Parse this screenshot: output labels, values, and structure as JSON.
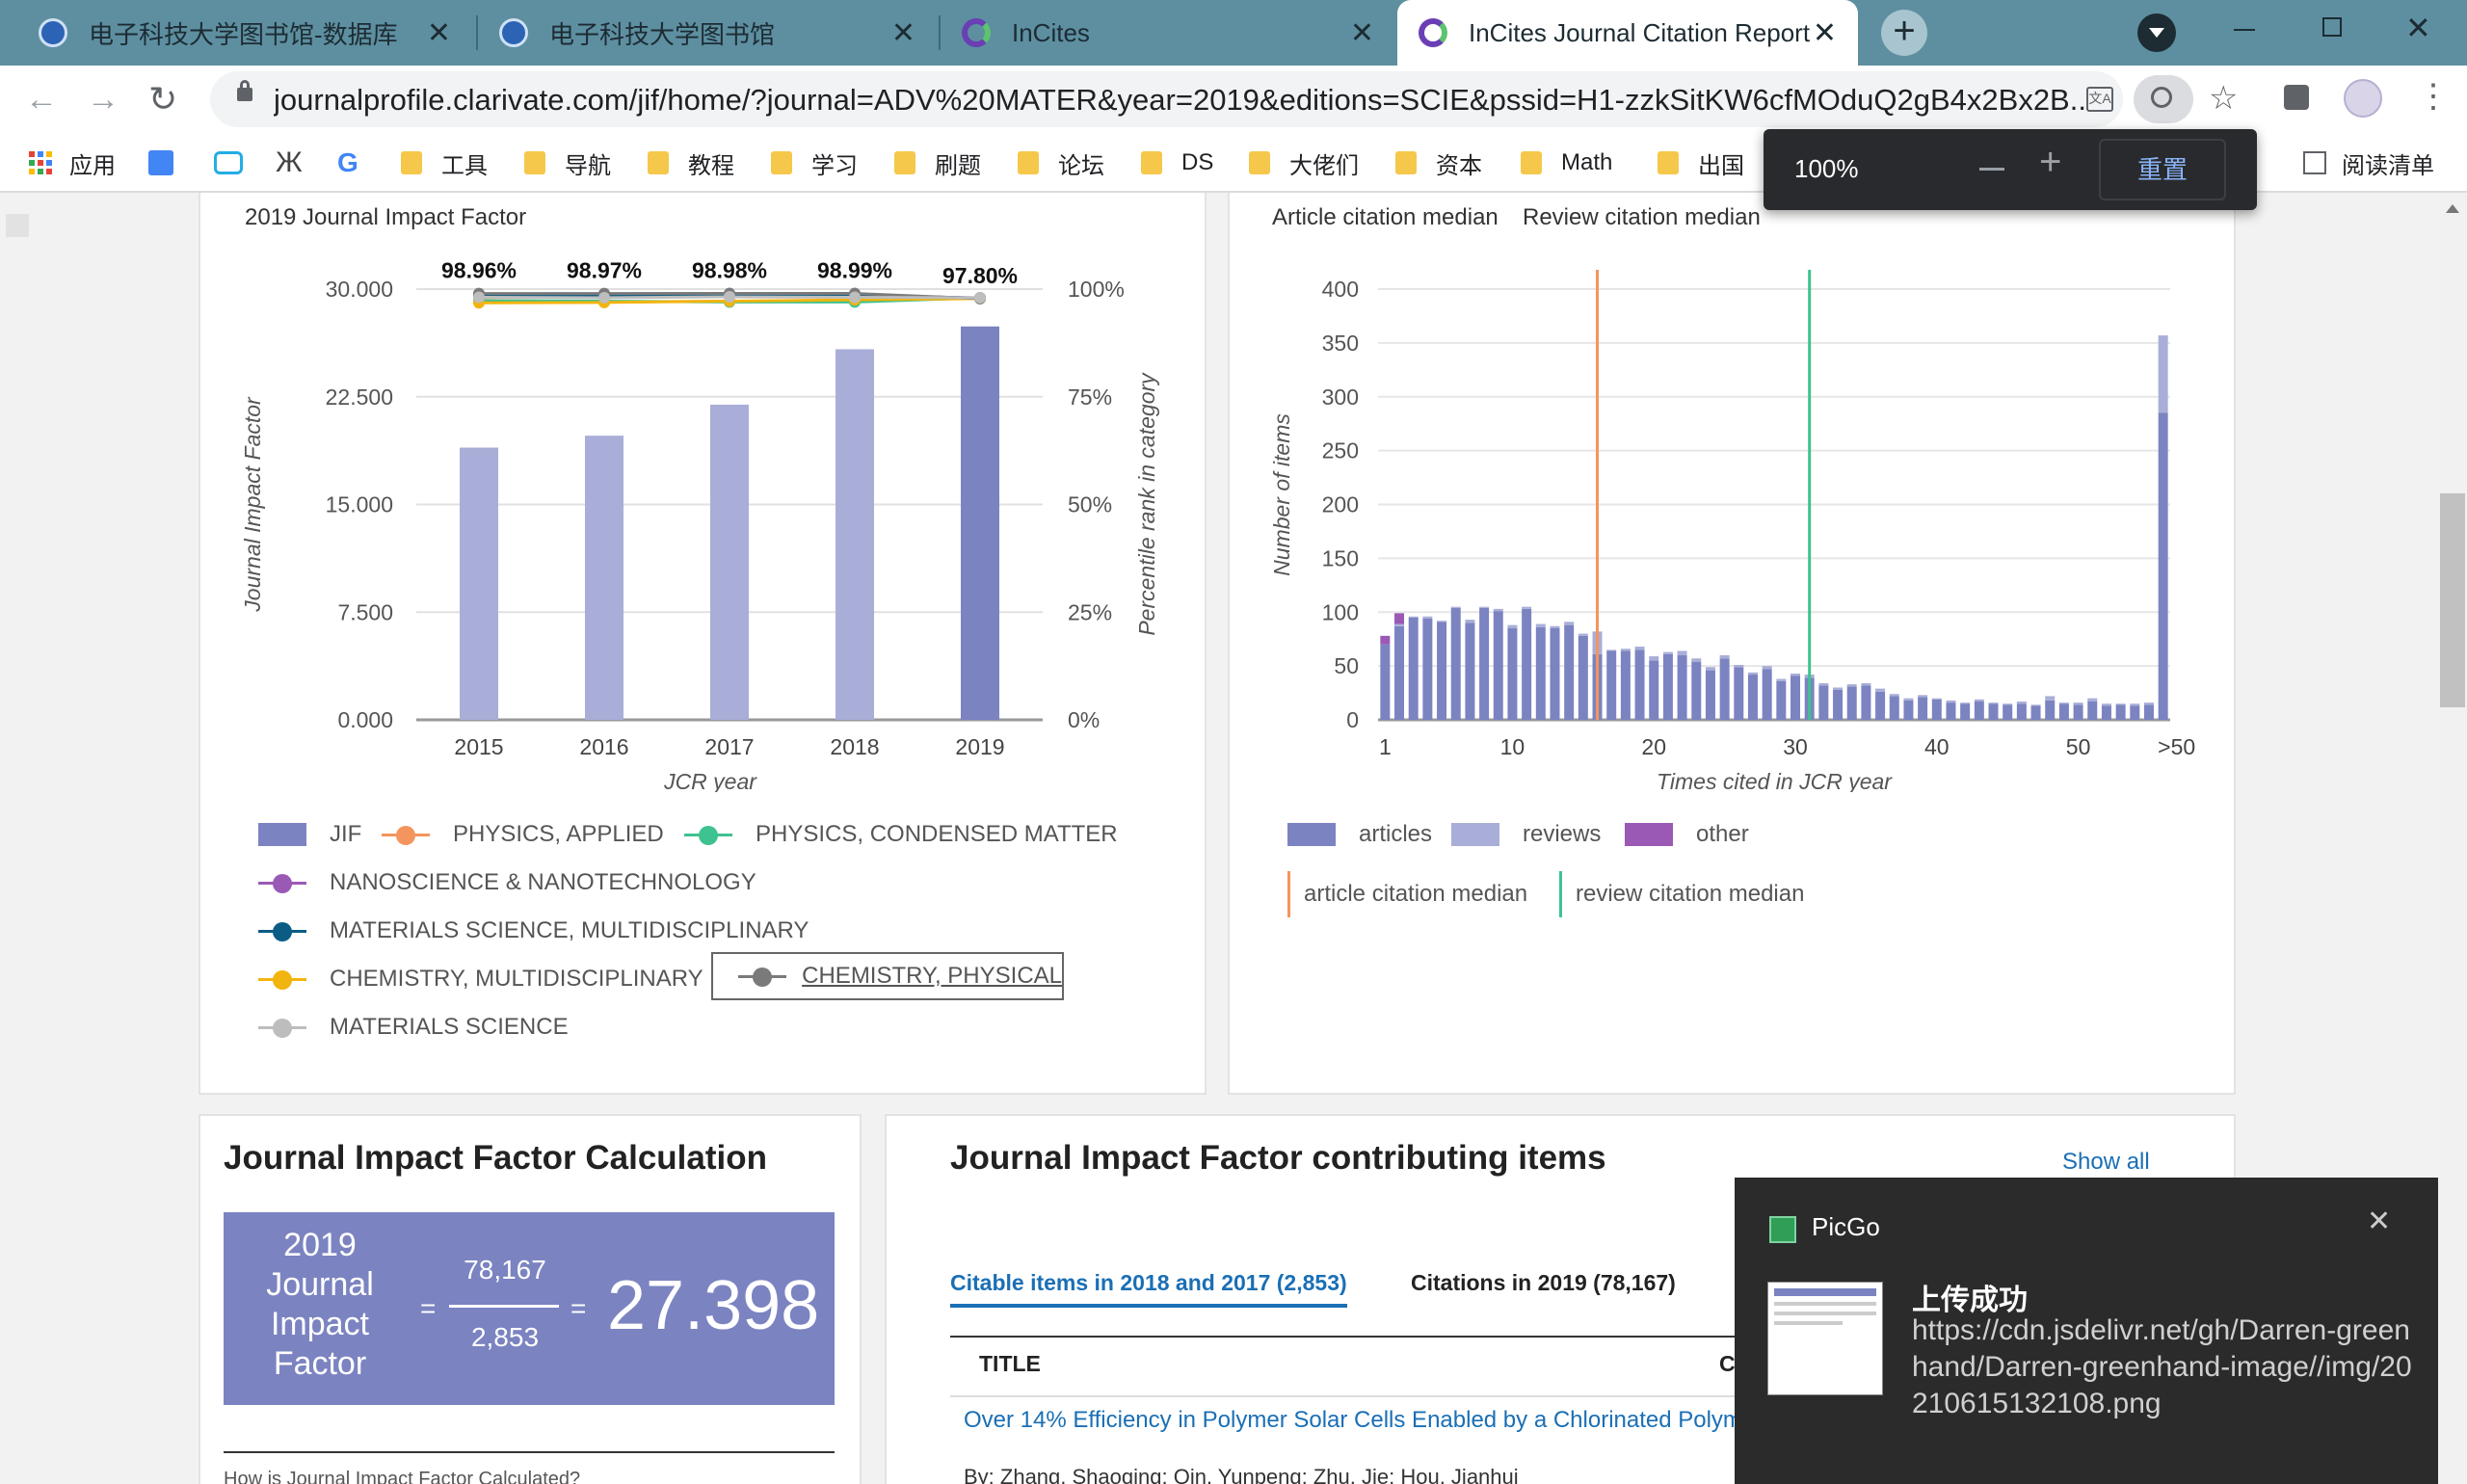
{
  "tabs": [
    {
      "title": "电子科技大学图书馆-数据库",
      "active": false
    },
    {
      "title": "电子科技大学图书馆",
      "active": false
    },
    {
      "title": "InCites",
      "active": false
    },
    {
      "title": "InCites Journal Citation Report",
      "active": true
    }
  ],
  "toolbar": {
    "url": "journalprofile.clarivate.com/jif/home/?journal=ADV%20MATER&year=2019&editions=SCIE&pssid=H1-zzkSitKW6cfMOduQ2gB4x2Bx2B..."
  },
  "bookmarks": {
    "apps_label": "应用",
    "items": [
      "工具",
      "导航",
      "教程",
      "学习",
      "刷题",
      "论坛",
      "DS",
      "大佬们",
      "资本",
      "Math",
      "出国"
    ],
    "reading_list": "阅读清单"
  },
  "zoom": {
    "level": "100%",
    "reset_label": "重置"
  },
  "jif_chart": {
    "title": "2019 Journal Impact Factor",
    "chart_data": {
      "type": "bar",
      "categories": [
        "2015",
        "2016",
        "2017",
        "2018",
        "2019"
      ],
      "values": [
        18.96,
        19.79,
        21.95,
        25.81,
        27.398
      ],
      "ylim": [
        0,
        30
      ],
      "y_ticks": [
        "0.000",
        "7.500",
        "15.000",
        "22.500",
        "30.000"
      ],
      "y2_ticks": [
        "0%",
        "25%",
        "50%",
        "75%",
        "100%"
      ],
      "xlabel": "JCR year",
      "ylabel": "Journal Impact Factor",
      "y2label": "Percentile rank in category",
      "percentile_labels": [
        "98.96%",
        "98.97%",
        "98.98%",
        "98.99%",
        "97.80%"
      ],
      "percentile_series": [
        {
          "name": "PHYSICS, APPLIED",
          "color": "#f4955e",
          "values": [
            97.4,
            97.0,
            97.2,
            97.3,
            97.9
          ]
        },
        {
          "name": "PHYSICS, CONDENSED MATTER",
          "color": "#3ec28f",
          "values": [
            97.3,
            97.2,
            97.0,
            97.0,
            98.0
          ]
        },
        {
          "name": "NANOSCIENCE & NANOTECHNOLOGY",
          "color": "#9b59b6",
          "values": [
            98.6,
            98.3,
            98.5,
            98.4,
            98.0
          ]
        },
        {
          "name": "MATERIALS SCIENCE, MULTIDISCIPLINARY",
          "color": "#0b5c85",
          "values": [
            98.4,
            98.6,
            98.4,
            98.6,
            97.9
          ]
        },
        {
          "name": "CHEMISTRY, MULTIDISCIPLINARY",
          "color": "#f2b40e",
          "values": [
            96.8,
            96.9,
            97.2,
            97.5,
            97.8
          ]
        },
        {
          "name": "CHEMISTRY, PHYSICAL",
          "color": "#7a7a7a",
          "values": [
            98.96,
            98.97,
            98.98,
            98.99,
            97.8
          ]
        },
        {
          "name": "MATERIALS SCIENCE",
          "color": "#bdbdbd",
          "values": [
            98.1,
            98.0,
            98.2,
            98.1,
            98.0
          ]
        }
      ]
    },
    "legend": {
      "jif": "JIF",
      "items": [
        "PHYSICS, APPLIED",
        "PHYSICS, CONDENSED MATTER",
        "NANOSCIENCE & NANOTECHNOLOGY",
        "MATERIALS SCIENCE, MULTIDISCIPLINARY",
        "CHEMISTRY, MULTIDISCIPLINARY",
        "CHEMISTRY, PHYSICAL",
        "MATERIALS SCIENCE"
      ]
    }
  },
  "citation_chart": {
    "header_article": "Article citation median",
    "header_review": "Review citation median",
    "chart_data": {
      "type": "bar",
      "xlabel": "Times cited in JCR year",
      "ylabel": "Number of items",
      "ylim": [
        0,
        400
      ],
      "y_ticks": [
        "0",
        "50",
        "100",
        "150",
        "200",
        "250",
        "300",
        "350",
        "400"
      ],
      "x_ticks": [
        "1",
        "10",
        "20",
        "30",
        "40",
        "50",
        ">50"
      ],
      "article_median": 16,
      "review_median": 31,
      "series": [
        {
          "name": "articles",
          "color": "#7b83c1",
          "values": [
            70,
            87,
            95,
            94,
            91,
            104,
            90,
            104,
            101,
            85,
            103,
            86,
            85,
            88,
            78,
            61,
            64,
            64,
            65,
            55,
            61,
            60,
            54,
            46,
            57,
            49,
            42,
            47,
            36,
            41,
            39,
            32,
            28,
            31,
            32,
            26,
            22,
            18,
            21,
            19,
            16,
            15,
            17,
            15,
            14,
            15,
            13,
            18,
            15,
            14,
            17,
            13,
            14,
            13,
            14,
            285
          ]
        },
        {
          "name": "reviews",
          "color": "#a9aed8",
          "values": [
            0,
            2,
            1,
            2,
            1,
            1,
            3,
            1,
            2,
            3,
            2,
            3,
            2,
            3,
            2,
            21,
            1,
            2,
            3,
            4,
            2,
            4,
            3,
            3,
            3,
            2,
            2,
            3,
            2,
            2,
            3,
            2,
            2,
            2,
            2,
            3,
            2,
            2,
            2,
            1,
            2,
            1,
            2,
            1,
            1,
            2,
            1,
            4,
            1,
            2,
            3,
            2,
            1,
            2,
            2,
            72
          ]
        },
        {
          "name": "other",
          "color": "#9b59b6",
          "values": [
            8,
            10,
            0,
            0,
            0,
            0,
            0,
            0,
            0,
            0,
            0,
            0,
            0,
            0,
            0,
            0,
            0,
            0,
            0,
            0,
            0,
            0,
            0,
            0,
            0,
            0,
            0,
            0,
            0,
            0,
            0,
            0,
            0,
            0,
            0,
            0,
            0,
            0,
            0,
            0,
            0,
            0,
            0,
            0,
            0,
            0,
            0,
            0,
            0,
            0,
            0,
            0,
            0,
            0,
            0,
            0
          ]
        }
      ],
      "article_median_color": "#f4955e",
      "review_median_color": "#3ec28f"
    },
    "legend": {
      "articles": "articles",
      "reviews": "reviews",
      "other": "other",
      "article_median": "article citation median",
      "review_median": "review citation median"
    }
  },
  "calc": {
    "title": "Journal Impact Factor Calculation",
    "label": "2019 Journal Impact Factor",
    "numerator": "78,167",
    "denominator": "2,853",
    "result": "27.398",
    "how_link": "How is Journal Impact Factor Calculated?"
  },
  "contrib": {
    "title": "Journal Impact Factor contributing items",
    "show_all": "Show all",
    "tab_citable": "Citable items in 2018 and 2017 (2,853)",
    "tab_citations": "Citations in 2019 (78,167)",
    "col_title": "TITLE",
    "col_c": "C",
    "row1_title": "Over 14% Efficiency in Polymer Solar Cells Enabled by a Chlorinated Polym",
    "row1_authors": "By: Zhang, Shaoqing; Qin, Yunpeng; Zhu, Jie; Hou, Jianhui"
  },
  "toast": {
    "app": "PicGo",
    "heading": "上传成功",
    "message": "https://cdn.jsdelivr.net/gh/Darren-greenhand/Darren-greenhand-image//img/20210615132108.png"
  }
}
